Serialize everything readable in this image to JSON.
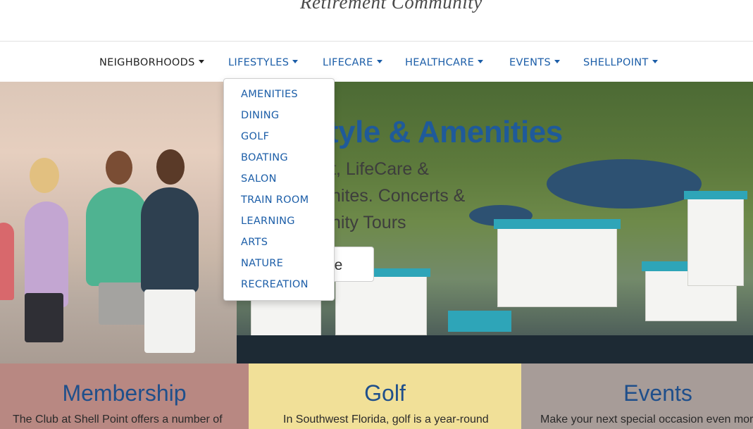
{
  "header": {
    "logo_text": "Retirement Community"
  },
  "nav": {
    "items": [
      {
        "label": "NEIGHBORHOODS"
      },
      {
        "label": "LIFESTYLES"
      },
      {
        "label": "LIFECARE"
      },
      {
        "label": "HEALTHCARE"
      },
      {
        "label": "EVENTS"
      },
      {
        "label": "SHELLPOINT"
      }
    ]
  },
  "dropdown": {
    "items": [
      "AMENITIES",
      "DINING",
      "GOLF",
      "BOATING",
      "SALON",
      "TRAIN ROOM",
      "LEARNING",
      "ARTS",
      "NATURE",
      "RECREATION"
    ]
  },
  "hero": {
    "title": "style & Amenities",
    "line1": "t, LifeCare &",
    "line2": "nites. Concerts &",
    "line3": "nity Tours",
    "button": "ore"
  },
  "cards": [
    {
      "title": "Membership",
      "text": "The Club at Shell Point offers a number of",
      "bg": "#b88882"
    },
    {
      "title": "Golf",
      "text": "In Southwest Florida, golf is a year-round",
      "bg": "#f1e098"
    },
    {
      "title": "Events",
      "text": "Make your next special occasion even mor",
      "bg": "#a79c98"
    }
  ],
  "colors": {
    "nav_link": "#1c5ea8",
    "title_blue": "#1f5a9a"
  }
}
